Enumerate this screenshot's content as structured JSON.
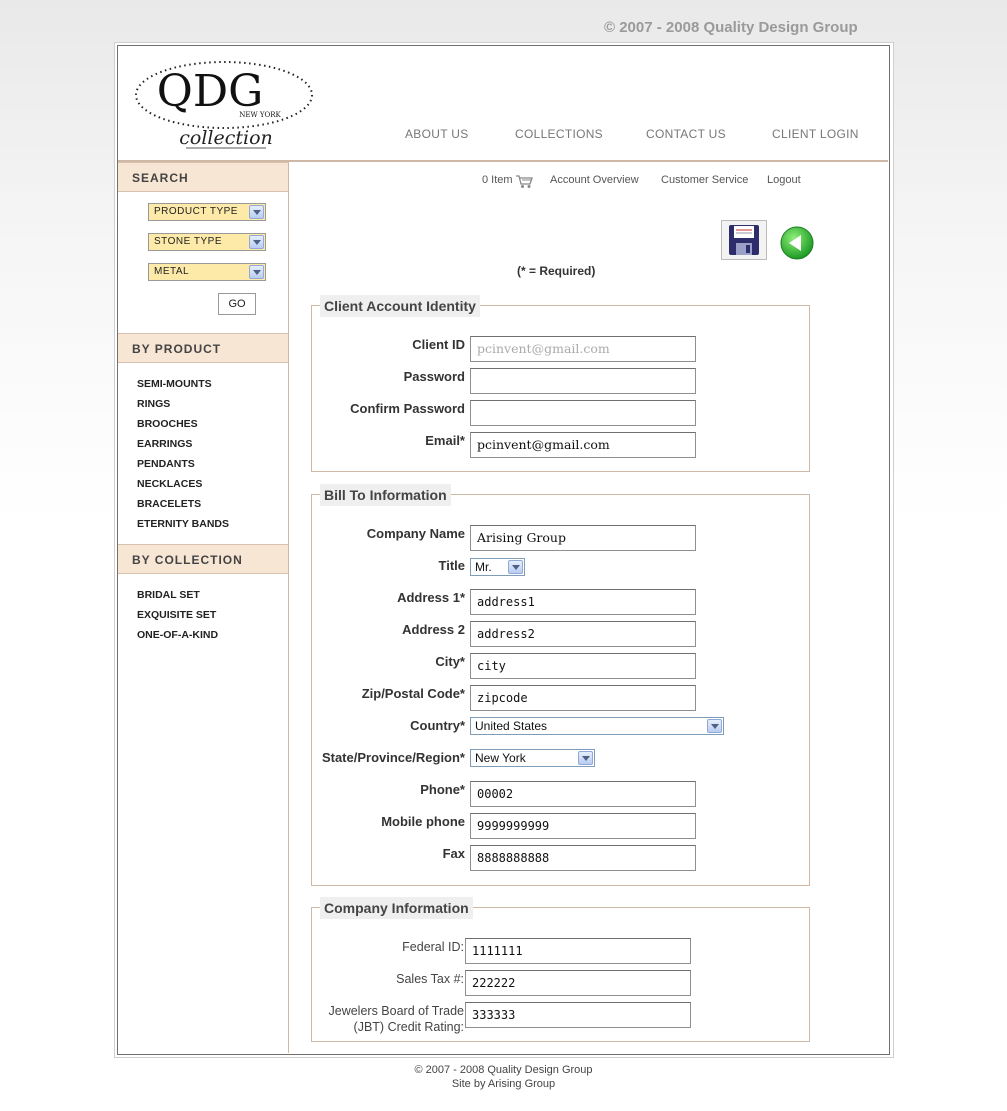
{
  "top_copyright": "© 2007 - 2008 Quality Design Group",
  "logo": {
    "big": "QDG",
    "sub": "NEW YORK",
    "script": "collection"
  },
  "nav": [
    "ABOUT US",
    "COLLECTIONS",
    "CONTACT US",
    "CLIENT LOGIN"
  ],
  "sidebar": {
    "search_title": "SEARCH",
    "selects": [
      "PRODUCT TYPE",
      "STONE TYPE",
      "METAL"
    ],
    "go_label": "GO",
    "by_product_title": "BY PRODUCT",
    "products": [
      "SEMI-MOUNTS",
      "RINGS",
      "BROOCHES",
      "EARRINGS",
      "PENDANTS",
      "NECKLACES",
      "BRACELETS",
      "ETERNITY BANDS"
    ],
    "by_collection_title": "BY COLLECTION",
    "collections": [
      "BRIDAL SET",
      "EXQUISITE SET",
      "ONE-OF-A-KIND"
    ]
  },
  "topbar": {
    "cart": "0 Item",
    "account": "Account Overview",
    "service": "Customer Service",
    "logout": "Logout"
  },
  "required_note": "(* = Required)",
  "identity": {
    "legend": "Client Account Identity",
    "client_id_label": "Client ID",
    "client_id_value": "pcinvent@gmail.com",
    "password_label": "Password",
    "confirm_label": "Confirm Password",
    "email_label": "Email*",
    "email_value": "pcinvent@gmail.com"
  },
  "billing": {
    "legend": "Bill To Information",
    "company_label": "Company Name",
    "company_value": "Arising Group",
    "title_label": "Title",
    "title_value": "Mr.",
    "address1_label": "Address 1*",
    "address1_value": "address1",
    "address2_label": "Address 2",
    "address2_value": "address2",
    "city_label": "City*",
    "city_value": "city",
    "zip_label": "Zip/Postal Code*",
    "zip_value": "zipcode",
    "country_label": "Country*",
    "country_value": "United States",
    "state_label": "State/Province/Region*",
    "state_value": "New York",
    "phone_label": "Phone*",
    "phone_value": "00002",
    "mobile_label": "Mobile phone",
    "mobile_value": "9999999999",
    "fax_label": "Fax",
    "fax_value": "8888888888"
  },
  "company": {
    "legend": "Company Information",
    "federal_label": "Federal ID:",
    "federal_value": "1111111",
    "salestax_label": "Sales Tax #:",
    "salestax_value": "222222",
    "jbt_label_1": "Jewelers Board of Trade",
    "jbt_label_2": "(JBT) Credit Rating:",
    "jbt_value": "333333"
  },
  "footer": {
    "line1": "© 2007 - 2008 Quality Design Group",
    "line2": "Site by Arising Group"
  }
}
